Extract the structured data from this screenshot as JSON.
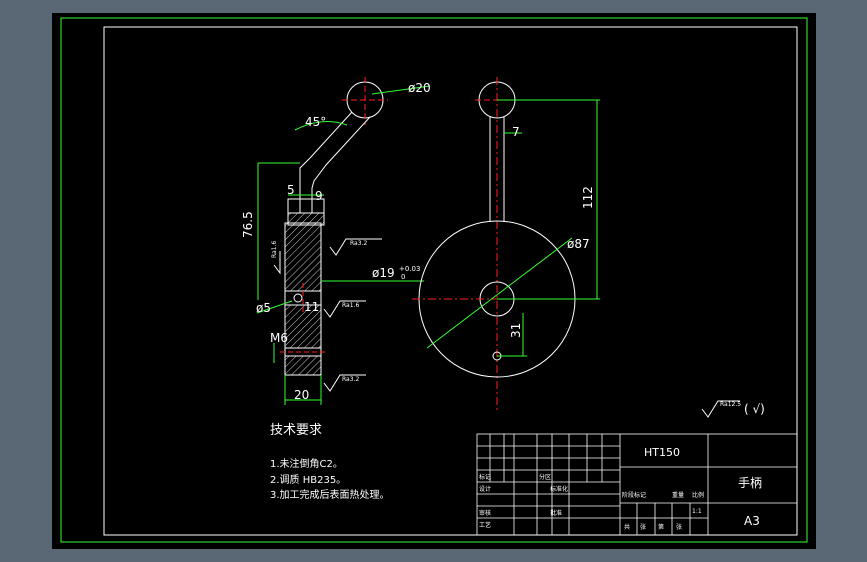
{
  "drawing": {
    "tech_req_title": "技术要求",
    "notes": [
      "1.未注倒角C2。",
      "2.调质 HB235。",
      "3.加工完成后表面热处理。"
    ],
    "dimensions": {
      "d20": "ø20",
      "angle45": "45°",
      "d7": "7",
      "d112": "112",
      "d87": "ø87",
      "d765": "76.5",
      "d9": "9",
      "d5top": "5",
      "d19": "ø19",
      "d19tol": "+0.03",
      "d19tol2": "0",
      "d5": "ø5",
      "d11": "11",
      "m6": "M6",
      "d20bottom": "20",
      "d31": "31"
    },
    "roughness": {
      "r1": "Ra3.2",
      "r2": "Ra1.6",
      "r3": "Ra3.2",
      "side": "Ra1.6",
      "general": "Ra12.5",
      "general_paren": "( √)"
    },
    "title_block": {
      "material": "HT150",
      "part_name": "手柄",
      "sheet_size": "A3",
      "row_labels": [
        "标记",
        "设计",
        "审核",
        "工艺"
      ],
      "mid_labels": [
        "分区",
        "标准化",
        "批准"
      ],
      "right_labels": [
        "阶段标记",
        "重量",
        "比例"
      ],
      "bottom_labels": [
        "共",
        "张",
        "第",
        "张"
      ],
      "scale_val": "1:1"
    }
  },
  "colors": {
    "outline": "#ffffff",
    "dimension": "#33ff33",
    "centerline": "#ff2020",
    "frame": "#33ff33",
    "text": "#ffffff"
  }
}
